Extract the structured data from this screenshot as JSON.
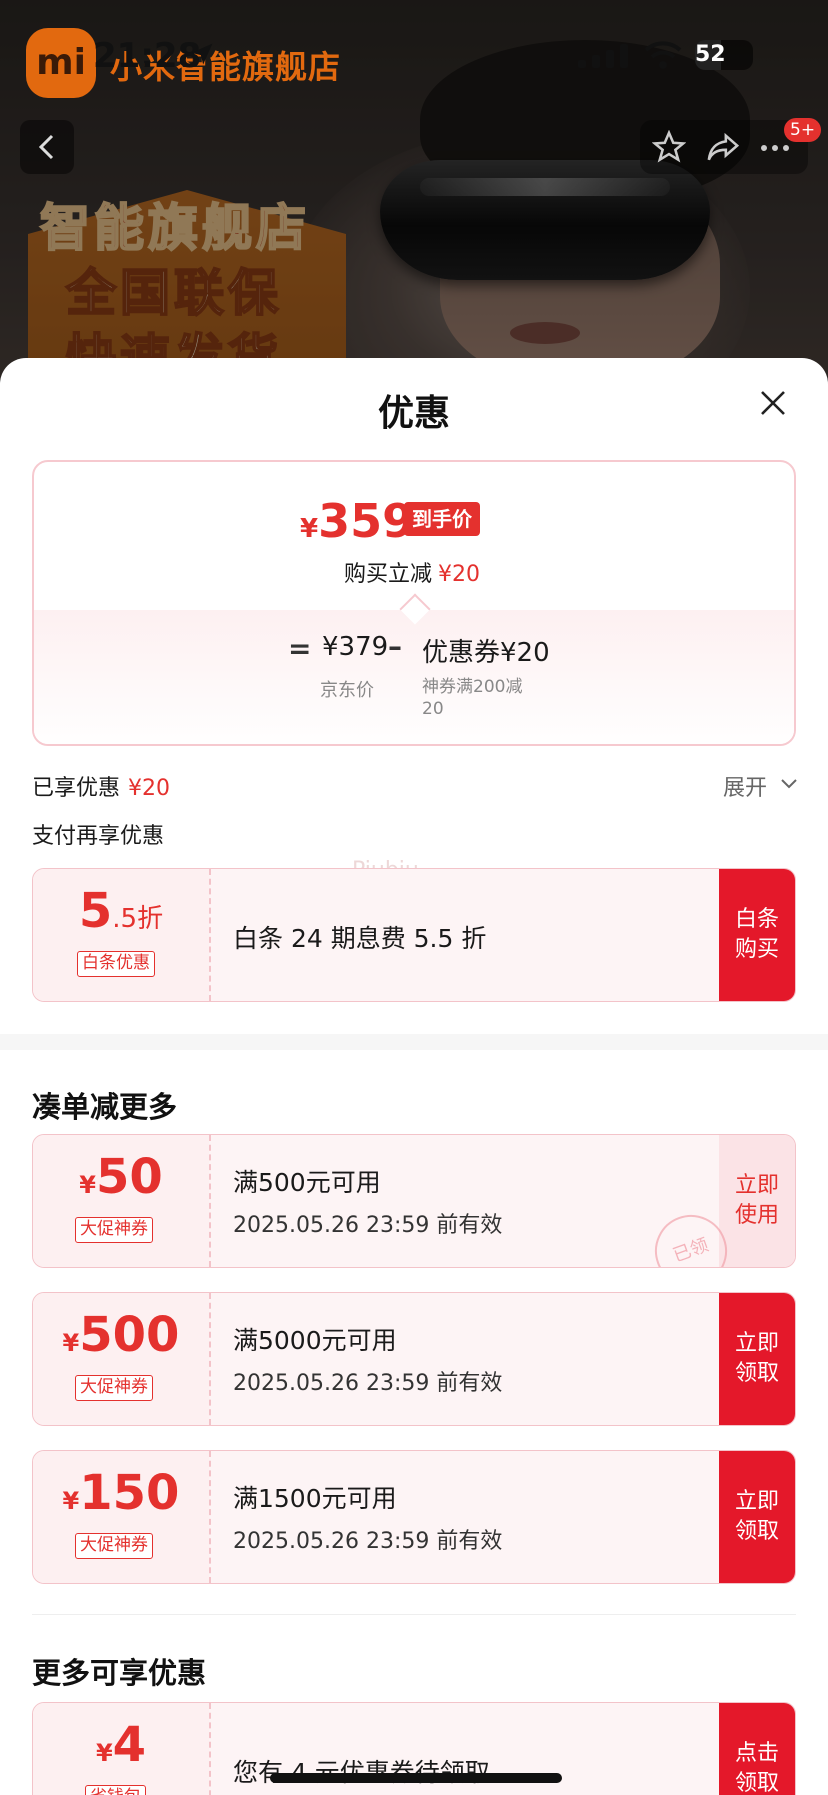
{
  "status_bar": {
    "time": "21:28",
    "battery": "52"
  },
  "store": {
    "logo_text": "mi",
    "name": "小米智能旗舰店"
  },
  "banner": {
    "line1": "智能旗舰店",
    "line2": "全国联保",
    "line3": "快速发货"
  },
  "nav": {
    "badge": "5+"
  },
  "sheet": {
    "title": "优惠",
    "summary": {
      "currency": "¥",
      "final_price": "359",
      "price_tag": "到手价",
      "buy_cut_label": "购买立减",
      "buy_cut_value": "¥20",
      "equals": "=",
      "jd_price": "¥379",
      "jd_label": "京东价",
      "minus": "–",
      "coupon_value": "优惠券¥20",
      "coupon_label": "神券满200减20"
    },
    "enjoyed_label": "已享优惠",
    "enjoyed_value": "¥20",
    "expand_label": "展开",
    "pay_more_label": "支付再享优惠",
    "watermark": "Piubiu"
  },
  "baitiao": {
    "amount": "5",
    "suffix": ".5折",
    "badge": "白条优惠",
    "desc": "白条 24 期息费 5.5 折",
    "action": "白条\n购买"
  },
  "section_more_label": "凑单减更多",
  "coupons": [
    {
      "currency": "¥",
      "amount": "50",
      "badge": "大促神券",
      "desc": "满500元可用",
      "date": "2025.05.26 23:59 前有效",
      "action": "立即\n使用",
      "state": "used",
      "stamp": "已领"
    },
    {
      "currency": "¥",
      "amount": "500",
      "badge": "大促神券",
      "desc": "满5000元可用",
      "date": "2025.05.26 23:59 前有效",
      "action": "立即\n领取",
      "state": "claim"
    },
    {
      "currency": "¥",
      "amount": "150",
      "badge": "大促神券",
      "desc": "满1500元可用",
      "date": "2025.05.26 23:59 前有效",
      "action": "立即\n领取",
      "state": "claim"
    }
  ],
  "section_extra_label": "更多可享优惠",
  "extra_coupon": {
    "currency": "¥",
    "amount": "4",
    "badge": "省钱包",
    "desc": "您有 4 元优惠券待领取",
    "action": "点击\n领取"
  },
  "colors": {
    "accent": "#e4312e",
    "action_bg": "#e4182a",
    "card_border": "#f3c3c9"
  }
}
